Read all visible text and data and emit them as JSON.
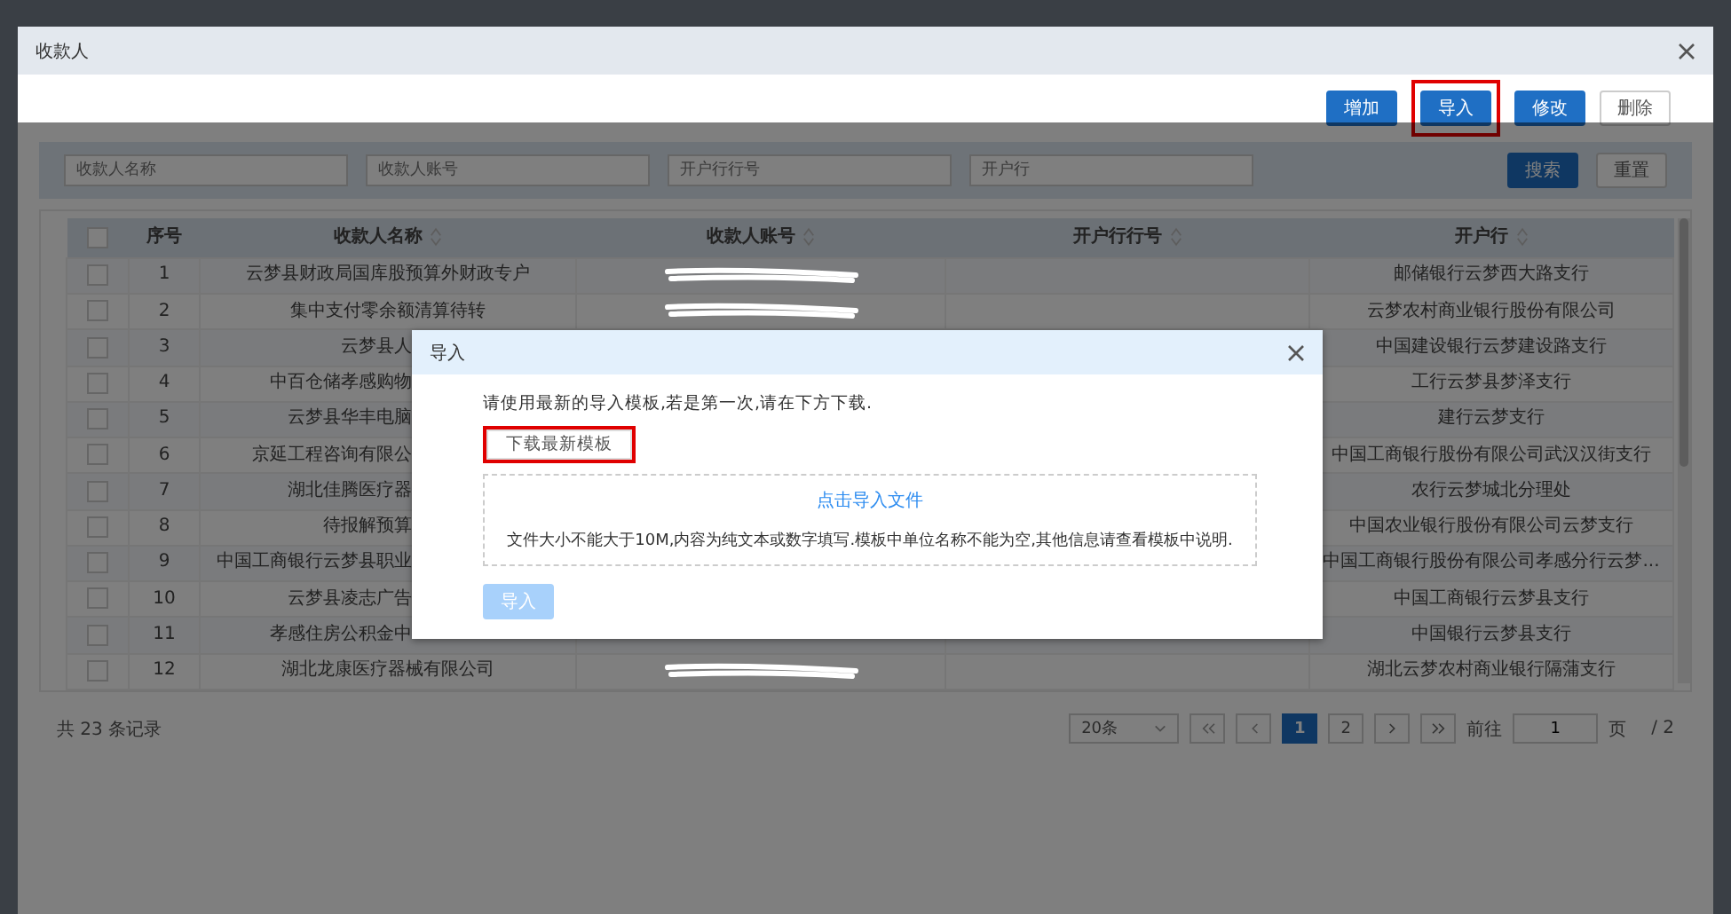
{
  "dialog": {
    "title": "收款人",
    "toolbar": [
      {
        "label": "增加",
        "kind": "primary",
        "highlighted": false
      },
      {
        "label": "导入",
        "kind": "primary",
        "highlighted": true
      },
      {
        "label": "修改",
        "kind": "primary",
        "highlighted": false
      },
      {
        "label": "删除",
        "kind": "default",
        "highlighted": false
      }
    ],
    "search": {
      "fields": [
        {
          "placeholder": "收款人名称"
        },
        {
          "placeholder": "收款人账号"
        },
        {
          "placeholder": "开户行行号"
        },
        {
          "placeholder": "开户行"
        }
      ],
      "buttons": [
        {
          "label": "搜索",
          "kind": "primary"
        },
        {
          "label": "重置",
          "kind": "default"
        }
      ]
    },
    "table": {
      "header_checked": false,
      "columns": [
        {
          "label": "序号",
          "sortable": false
        },
        {
          "label": "收款人名称",
          "sortable": true
        },
        {
          "label": "收款人账号",
          "sortable": true
        },
        {
          "label": "开户行行号",
          "sortable": true
        },
        {
          "label": "开户行",
          "sortable": true
        }
      ],
      "rows": [
        {
          "checked": false,
          "index": "1",
          "name": "云梦县财政局国库股预算外财政专户",
          "bank": "邮储银行云梦西大路支行"
        },
        {
          "checked": false,
          "index": "2",
          "name": "集中支付零余额清算待转",
          "bank": "云梦农村商业银行股份有限公司"
        },
        {
          "checked": false,
          "index": "3",
          "name": "云梦县人",
          "bank": "中国建设银行云梦建设路支行"
        },
        {
          "checked": false,
          "index": "4",
          "name": "中百仓储孝感购物",
          "bank": "工行云梦县梦泽支行"
        },
        {
          "checked": false,
          "index": "5",
          "name": "云梦县华丰电脑",
          "bank": "建行云梦支行"
        },
        {
          "checked": false,
          "index": "6",
          "name": "京延工程咨询有限公",
          "bank": "中国工商银行股份有限公司武汉汉街支行"
        },
        {
          "checked": false,
          "index": "7",
          "name": "湖北佳腾医疗器",
          "bank": "农行云梦城北分理处"
        },
        {
          "checked": false,
          "index": "8",
          "name": "待报解预算",
          "bank": "中国农业银行股份有限公司云梦支行"
        },
        {
          "checked": false,
          "index": "9",
          "name": "中国工商银行云梦县职业",
          "bank": "中国工商银行股份有限公司孝感分行云梦..."
        },
        {
          "checked": false,
          "index": "10",
          "name": "云梦县凌志广告",
          "bank": "中国工商银行云梦县支行"
        },
        {
          "checked": false,
          "index": "11",
          "name": "孝感住房公积金中",
          "bank": "中国银行云梦县支行"
        },
        {
          "checked": false,
          "index": "12",
          "name": "湖北龙康医疗器械有限公司",
          "bank": "湖北云梦农村商业银行隔蒲支行"
        }
      ]
    },
    "footer": {
      "total": "共 23 条记录",
      "page_size": "20条",
      "pages": [
        {
          "label": "1",
          "selected": true
        },
        {
          "label": "2",
          "selected": false
        }
      ],
      "goto_label": "前往",
      "goto_value": "1",
      "page_unit": "页",
      "page_count": "/ 2"
    }
  },
  "import_modal": {
    "title": "导入",
    "instruction": "请使用最新的导入模板,若是第一次,请在下方下载.",
    "download_button": {
      "label": "下载最新模板",
      "highlighted": true
    },
    "upload_link": "点击导入文件",
    "upload_note": "文件大小不能大于10M,内容为纯文本或数字填写.模板中单位名称不能为空,其他信息请查看模板中说明.",
    "submit_button": {
      "label": "导入",
      "disabled": true
    }
  }
}
